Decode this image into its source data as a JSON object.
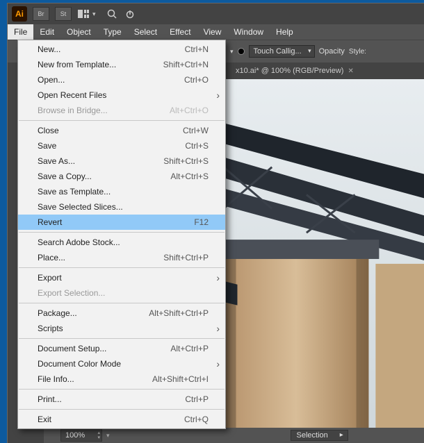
{
  "titlebar": {
    "logo": "Ai",
    "br": "Br",
    "st": "St"
  },
  "menubar": [
    "File",
    "Edit",
    "Object",
    "Type",
    "Select",
    "Effect",
    "View",
    "Window",
    "Help"
  ],
  "options": {
    "brush": "Touch Callig...",
    "opacity_label": "Opacity",
    "style_label": "Style:"
  },
  "doctab": {
    "title": "x10.ai* @ 100% (RGB/Preview)"
  },
  "status": {
    "zoom": "100%",
    "selection": "Selection"
  },
  "file_menu": [
    {
      "label": "New...",
      "accel": "Ctrl+N"
    },
    {
      "label": "New from Template...",
      "accel": "Shift+Ctrl+N"
    },
    {
      "label": "Open...",
      "accel": "Ctrl+O"
    },
    {
      "label": "Open Recent Files",
      "sub": true
    },
    {
      "label": "Browse in Bridge...",
      "accel": "Alt+Ctrl+O",
      "disabled": true
    },
    {
      "sep": true
    },
    {
      "label": "Close",
      "accel": "Ctrl+W"
    },
    {
      "label": "Save",
      "accel": "Ctrl+S"
    },
    {
      "label": "Save As...",
      "accel": "Shift+Ctrl+S"
    },
    {
      "label": "Save a Copy...",
      "accel": "Alt+Ctrl+S"
    },
    {
      "label": "Save as Template..."
    },
    {
      "label": "Save Selected Slices..."
    },
    {
      "label": "Revert",
      "accel": "F12",
      "highlight": true
    },
    {
      "sep": true
    },
    {
      "label": "Search Adobe Stock..."
    },
    {
      "label": "Place...",
      "accel": "Shift+Ctrl+P"
    },
    {
      "sep": true
    },
    {
      "label": "Export",
      "sub": true
    },
    {
      "label": "Export Selection...",
      "disabled": true
    },
    {
      "sep": true
    },
    {
      "label": "Package...",
      "accel": "Alt+Shift+Ctrl+P"
    },
    {
      "label": "Scripts",
      "sub": true
    },
    {
      "sep": true
    },
    {
      "label": "Document Setup...",
      "accel": "Alt+Ctrl+P"
    },
    {
      "label": "Document Color Mode",
      "sub": true
    },
    {
      "label": "File Info...",
      "accel": "Alt+Shift+Ctrl+I"
    },
    {
      "sep": true
    },
    {
      "label": "Print...",
      "accel": "Ctrl+P"
    },
    {
      "sep": true
    },
    {
      "label": "Exit",
      "accel": "Ctrl+Q"
    }
  ]
}
